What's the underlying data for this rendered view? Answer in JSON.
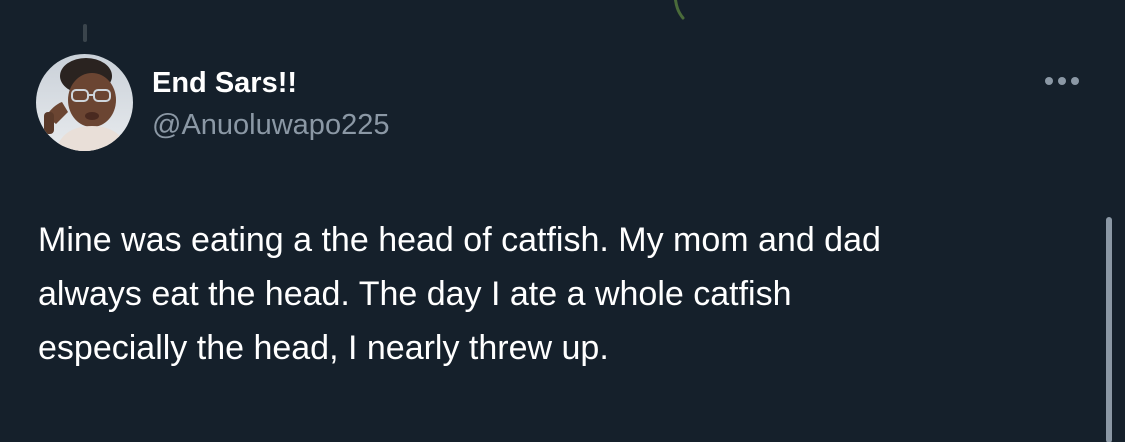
{
  "tweet": {
    "author": {
      "display_name": "End Sars!!",
      "handle": "@Anuoluwapo225"
    },
    "text": "Mine was eating a the head of catfish. My mom and dad\nalways eat the head. The day I ate a whole catfish\nespecially the head, I nearly threw up."
  },
  "icons": {
    "more": "more-horizontal-icon"
  },
  "colors": {
    "background": "#15202b",
    "primary_text": "#ffffff",
    "secondary_text": "#8b98a5"
  }
}
